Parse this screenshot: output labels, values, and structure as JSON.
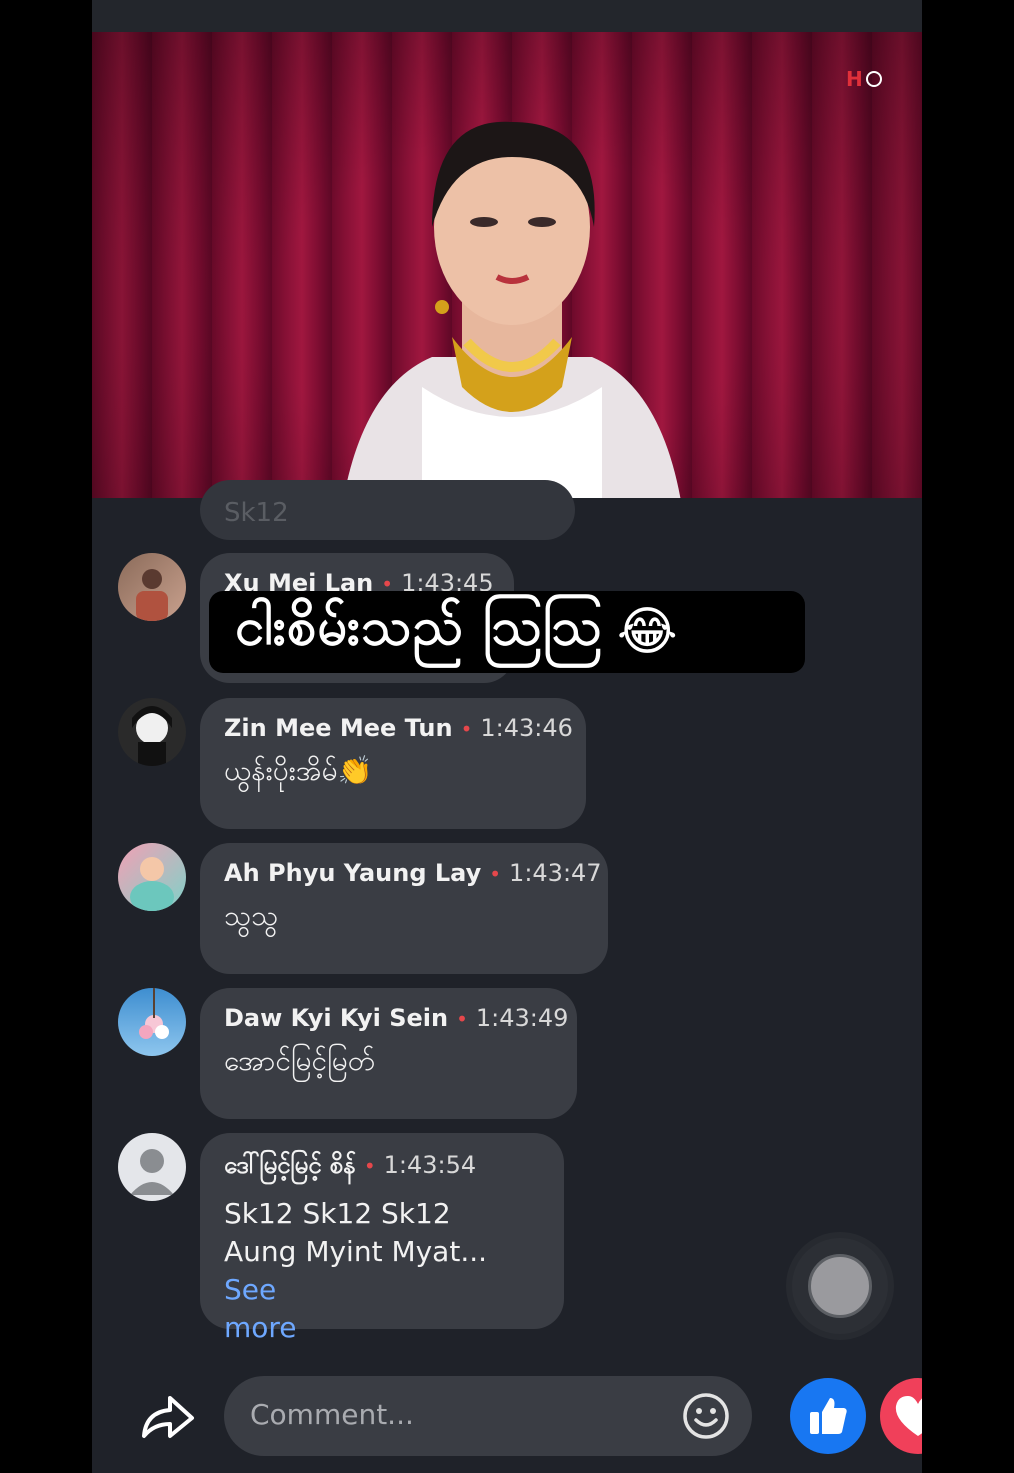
{
  "video": {
    "channel_logo_text": "H",
    "caption_text": "ငါးစိမ်းသည် သြသြ",
    "caption_emoji": "😂"
  },
  "comments": [
    {
      "name": "Sk12",
      "time": "",
      "text": "Sk12"
    },
    {
      "name": "Xu Mei Lan",
      "time": "1:43:45",
      "text": ""
    },
    {
      "name": "Zin Mee Mee Tun",
      "time": "1:43:46",
      "text": "ယွန်းပိုးအိမ်👏"
    },
    {
      "name": "Ah Phyu Yaung Lay",
      "time": "1:43:47",
      "text": "သွသွ"
    },
    {
      "name": "Daw Kyi Kyi Sein",
      "time": "1:43:49",
      "text": "အောင်မြင့်မြတ်"
    },
    {
      "name": "ဒေါ်မြင့်မြင့် စိန်",
      "time": "1:43:54",
      "text_line1": "Sk12 Sk12 Sk12",
      "text_line2": "Aung Myint Myat...",
      "see_more_1": "See",
      "see_more_2": "more"
    }
  ],
  "bottom": {
    "comment_placeholder": "Comment..."
  },
  "colors": {
    "background": "#1f2229",
    "bubble": "#3a3d44",
    "like_blue": "#1877f2",
    "love_red": "#f0405a",
    "see_more": "#6ea8ff"
  }
}
